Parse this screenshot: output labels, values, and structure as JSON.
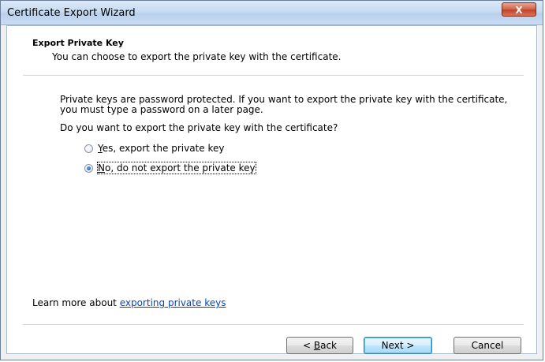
{
  "window": {
    "title": "Certificate Export Wizard",
    "close_glyph": "X"
  },
  "header": {
    "title": "Export Private Key",
    "subtitle": "You can choose to export the private key with the certificate."
  },
  "body": {
    "info": "Private keys are password protected. If you want to export the private key with the certificate, you must type a password on a later page.",
    "question": "Do you want to export the private key with the certificate?"
  },
  "options": [
    {
      "label": "Yes, export the private key",
      "mnemonic": "Y",
      "rest": "es, export the private key",
      "checked": false
    },
    {
      "label": "No, do not export the private key",
      "mnemonic": "N",
      "rest": "o, do not export the private key",
      "checked": true
    }
  ],
  "learn_more": {
    "prefix": "Learn more about ",
    "link": "exporting private keys"
  },
  "buttons": {
    "back_prefix": "< ",
    "back_mnemonic": "B",
    "back_rest": "ack",
    "next": "Next >",
    "cancel": "Cancel"
  },
  "colors": {
    "link": "#0044cc",
    "close_button": "#c2432a",
    "title_bar": "#c7dbf2"
  }
}
